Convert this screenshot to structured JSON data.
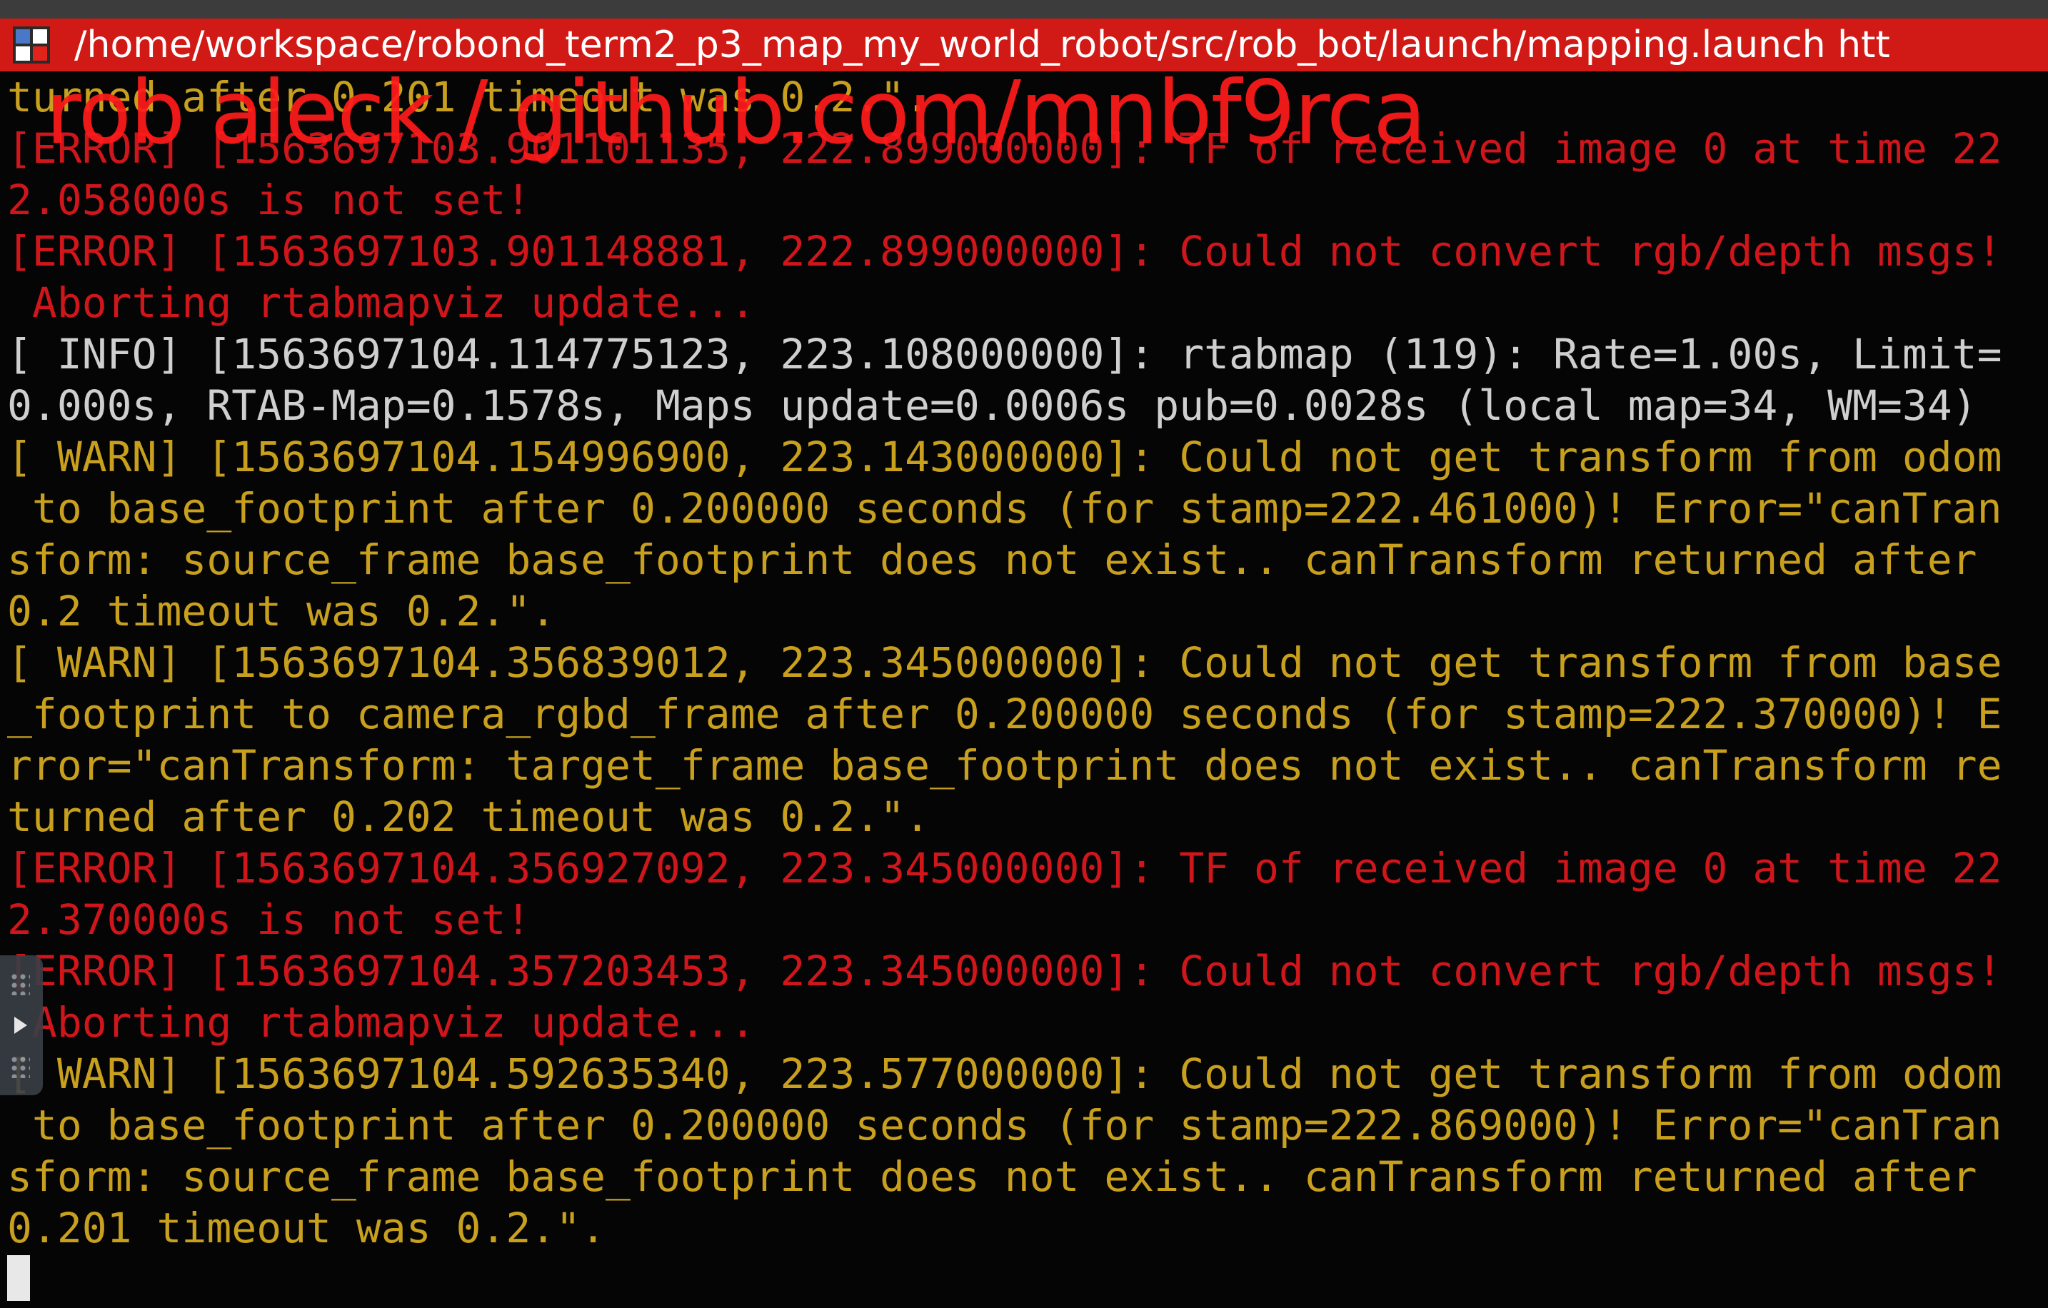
{
  "window": {
    "title": "/home/workspace/robond_term2_p3_map_my_world_robot/src/rob_bot/launch/mapping.launch htt"
  },
  "terminal": {
    "lines": [
      {
        "text": "turned after 0.201 timeout was 0.2.\".",
        "color": "#c8a01e"
      },
      {
        "text": "[ERROR] [1563697103.901101135, 222.899000000]: TF of received image 0 at time 22",
        "color": "#d0161b"
      },
      {
        "text": "2.058000s is not set!",
        "color": "#d0161b"
      },
      {
        "text": "[ERROR] [1563697103.901148881, 222.899000000]: Could not convert rgb/depth msgs!",
        "color": "#d0161b"
      },
      {
        "text": " Aborting rtabmapviz update...",
        "color": "#d0161b"
      },
      {
        "text": "[ INFO] [1563697104.114775123, 223.108000000]: rtabmap (119): Rate=1.00s, Limit=",
        "color": "#cfcfcf"
      },
      {
        "text": "0.000s, RTAB-Map=0.1578s, Maps update=0.0006s pub=0.0028s (local map=34, WM=34)",
        "color": "#cfcfcf"
      },
      {
        "text": "[ WARN] [1563697104.154996900, 223.143000000]: Could not get transform from odom",
        "color": "#c8a01e"
      },
      {
        "text": " to base_footprint after 0.200000 seconds (for stamp=222.461000)! Error=\"canTran",
        "color": "#c8a01e"
      },
      {
        "text": "sform: source_frame base_footprint does not exist.. canTransform returned after",
        "color": "#c8a01e"
      },
      {
        "text": "0.2 timeout was 0.2.\".",
        "color": "#c8a01e"
      },
      {
        "text": "[ WARN] [1563697104.356839012, 223.345000000]: Could not get transform from base",
        "color": "#c8a01e"
      },
      {
        "text": "_footprint to camera_rgbd_frame after 0.200000 seconds (for stamp=222.370000)! E",
        "color": "#c8a01e"
      },
      {
        "text": "rror=\"canTransform: target_frame base_footprint does not exist.. canTransform re",
        "color": "#c8a01e"
      },
      {
        "text": "turned after 0.202 timeout was 0.2.\".",
        "color": "#c8a01e"
      },
      {
        "text": "[ERROR] [1563697104.356927092, 223.345000000]: TF of received image 0 at time 22",
        "color": "#d0161b"
      },
      {
        "text": "2.370000s is not set!",
        "color": "#d0161b"
      },
      {
        "text": "[ERROR] [1563697104.357203453, 223.345000000]: Could not convert rgb/depth msgs!",
        "color": "#d0161b"
      },
      {
        "text": " Aborting rtabmapviz update...",
        "color": "#d0161b"
      },
      {
        "text": "[ WARN] [1563697104.592635340, 223.577000000]: Could not get transform from odom",
        "color": "#c8a01e"
      },
      {
        "text": " to base_footprint after 0.200000 seconds (for stamp=222.869000)! Error=\"canTran",
        "color": "#c8a01e"
      },
      {
        "text": "sform: source_frame base_footprint does not exist.. canTransform returned after",
        "color": "#c8a01e"
      },
      {
        "text": "0.201 timeout was 0.2.\".",
        "color": "#c8a01e"
      }
    ]
  },
  "watermark": {
    "text": "rob aleck / github.com/mnbf9rca"
  },
  "icons": {
    "app": "terminal-app-icon",
    "side_handle": "play-icon"
  },
  "colors": {
    "titlebar": "#d11a16",
    "error": "#d0161b",
    "warn": "#c8a01e",
    "info": "#cfcfcf",
    "background": "#050505"
  }
}
